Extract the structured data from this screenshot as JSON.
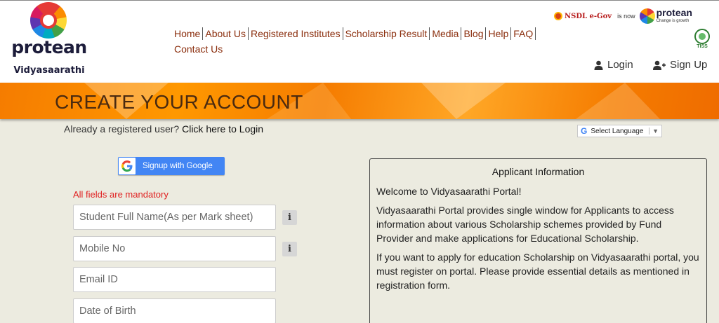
{
  "brand": {
    "name": "protean",
    "subtitle": "Vidyasaarathi"
  },
  "nav": {
    "items": [
      "Home",
      "About Us",
      "Registered Institutes",
      "Scholarship Result",
      "Media",
      "Blog",
      "Help",
      "FAQ"
    ],
    "contact": "Contact Us"
  },
  "partner": {
    "nsdl": "NSDL e-Gov",
    "is_now": "is now",
    "protean": "protean",
    "tagline": "Change is growth",
    "tiss": "TISS"
  },
  "auth": {
    "login": "Login",
    "signup": "Sign Up"
  },
  "banner": {
    "title": "CREATE YOUR ACCOUNT"
  },
  "login_prompt": {
    "text": "Already a registered user?",
    "link": "Click here to Login"
  },
  "language": {
    "label": "Select Language",
    "g": "G",
    "arrow": "▼"
  },
  "google": {
    "label": "Signup with Google"
  },
  "form": {
    "mandatory": "All fields are mandatory",
    "fields": [
      {
        "placeholder": "Student Full Name(As per Mark sheet)"
      },
      {
        "placeholder": "Mobile No"
      },
      {
        "placeholder": "Email ID"
      },
      {
        "placeholder": "Date of Birth"
      }
    ],
    "info": "i"
  },
  "info_panel": {
    "title": "Applicant Information",
    "paragraphs": [
      "Welcome to Vidyasaarathi Portal!",
      "Vidyasaarathi Portal provides single window for Applicants to access information about various Scholarship schemes provided by Fund Provider and make applications for Educational Scholarship.",
      "If you want to apply for education Scholarship on Vidyasaarathi portal, you must register on portal. Please provide essential details as mentioned in registration form."
    ]
  }
}
